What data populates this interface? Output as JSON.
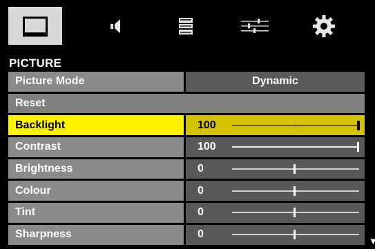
{
  "tabs": [
    {
      "icon": "picture-icon",
      "active": true
    },
    {
      "icon": "speaker-icon",
      "active": false
    },
    {
      "icon": "channel-list-icon",
      "active": false
    },
    {
      "icon": "settings-sliders-icon",
      "active": false
    },
    {
      "icon": "gear-icon",
      "active": false
    }
  ],
  "section_title": "PICTURE",
  "menu": {
    "picture_mode": {
      "label": "Picture Mode",
      "value": "Dynamic"
    },
    "reset": {
      "label": "Reset"
    },
    "backlight": {
      "label": "Backlight",
      "value": "100",
      "level": 1.0
    },
    "contrast": {
      "label": "Contrast",
      "value": "100",
      "level": 1.0
    },
    "brightness": {
      "label": "Brightness",
      "value": "0",
      "level": 0.5
    },
    "colour": {
      "label": "Colour",
      "value": "0",
      "level": 0.5
    },
    "tint": {
      "label": "Tint",
      "value": "0",
      "level": 0.5
    },
    "sharpness": {
      "label": "Sharpness",
      "value": "0",
      "level": 0.5
    }
  },
  "selected_item": "backlight",
  "colors": {
    "highlight": "#fff200",
    "row_label": "#8a8a8a",
    "row_value": "#595959",
    "tab_active": "#d8d8d8"
  },
  "scroll_indicator": "down-arrow-icon"
}
